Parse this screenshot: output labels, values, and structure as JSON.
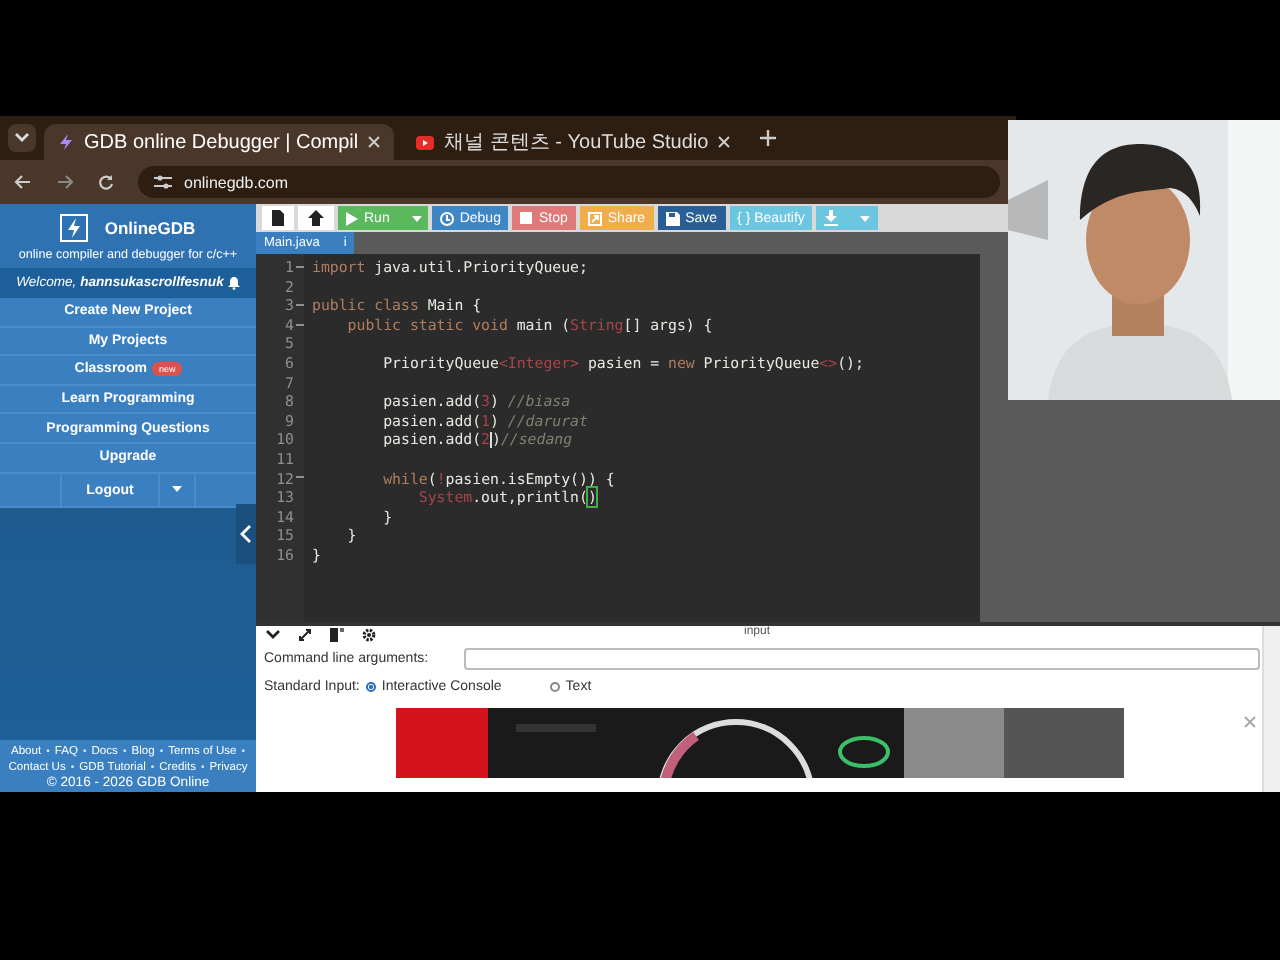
{
  "browser": {
    "tabs": [
      {
        "title": "GDB online Debugger | Compil",
        "selected": true,
        "kind": "gdb"
      },
      {
        "title": "채널 콘텐츠 - YouTube Studio",
        "selected": false,
        "kind": "youtube"
      }
    ],
    "url": "onlinegdb.com"
  },
  "sidebar": {
    "brand": "OnlineGDB",
    "tagline": "online compiler and debugger for c/c++",
    "welcome": "Welcome, **hannsukascrollfesnuk**",
    "menu": [
      {
        "label": "Create New Project",
        "kind": "link"
      },
      {
        "label": "My Projects",
        "kind": "link"
      },
      {
        "label": "Classroom",
        "kind": "link",
        "badge": "new"
      },
      {
        "label": "Learn Programming",
        "kind": "link"
      },
      {
        "label": "Programming Questions",
        "kind": "link"
      },
      {
        "label": "Upgrade",
        "kind": "link"
      },
      {
        "label": "Logout",
        "kind": "dropdown"
      }
    ],
    "footer": [
      [
        {
          "kind": "link",
          "text": "About"
        },
        {
          "kind": "sep",
          "text": "•"
        },
        {
          "kind": "link",
          "text": "FAQ"
        },
        {
          "kind": "sep",
          "text": "•"
        },
        {
          "kind": "link",
          "text": "Docs"
        },
        {
          "kind": "sep",
          "text": "•"
        },
        {
          "kind": "link",
          "text": "Blog"
        },
        {
          "kind": "sep",
          "text": "•"
        },
        {
          "kind": "link",
          "text": "Terms of Use"
        },
        {
          "kind": "sep",
          "text": "•"
        }
      ],
      [
        {
          "kind": "link",
          "text": "Contact Us"
        },
        {
          "kind": "sep",
          "text": "•"
        },
        {
          "kind": "link",
          "text": "GDB Tutorial"
        },
        {
          "kind": "sep",
          "text": "•"
        },
        {
          "kind": "link",
          "text": "Credits"
        },
        {
          "kind": "sep",
          "text": "•"
        },
        {
          "kind": "link",
          "text": "Privacy"
        }
      ]
    ],
    "copyright": "© 2016 - 2026 GDB Online"
  },
  "toolbar": [
    {
      "kind": "new-file"
    },
    {
      "kind": "upload"
    },
    {
      "kind": "run",
      "label": "Run",
      "caret": true
    },
    {
      "kind": "debug",
      "label": "Debug"
    },
    {
      "kind": "stop",
      "label": "Stop"
    },
    {
      "kind": "share",
      "label": "Share"
    },
    {
      "kind": "save",
      "label": "Save"
    },
    {
      "kind": "beautify",
      "label": "{ } Beautify"
    },
    {
      "kind": "download",
      "caret": true
    }
  ],
  "file_tab": {
    "name": "Main.java",
    "info": "i"
  },
  "code": [
    {
      "n": "1",
      "fold": true,
      "tokens": [
        {
          "kind": "kw",
          "t": "import"
        },
        {
          "kind": "plain",
          "t": " java.util.PriorityQueue;"
        }
      ]
    },
    {
      "n": "2",
      "fold": false
    },
    {
      "n": "3",
      "fold": true,
      "tokens": [
        {
          "kind": "kw",
          "t": "public class"
        },
        {
          "kind": "plain",
          "t": " Main {"
        }
      ]
    },
    {
      "n": "4",
      "fold": true,
      "tokens": [
        {
          "kind": "kw",
          "t": "    public static void"
        },
        {
          "kind": "plain",
          "t": " main ("
        },
        {
          "kind": "type",
          "t": "String"
        },
        {
          "kind": "plain",
          "t": "[] args) {"
        }
      ]
    },
    {
      "n": "5",
      "fold": false
    },
    {
      "n": "6",
      "fold": false,
      "tokens": [
        {
          "kind": "plain",
          "t": "        PriorityQueue"
        },
        {
          "kind": "type",
          "t": "<Integer>"
        },
        {
          "kind": "plain",
          "t": " pasien = "
        },
        {
          "kind": "kw",
          "t": "new"
        },
        {
          "kind": "plain",
          "t": " PriorityQueue"
        },
        {
          "kind": "type",
          "t": "<>"
        },
        {
          "kind": "plain",
          "t": "();"
        }
      ]
    },
    {
      "n": "7",
      "fold": false
    },
    {
      "n": "8",
      "fold": false,
      "tokens": [
        {
          "kind": "plain",
          "t": "        pasien.add("
        },
        {
          "kind": "num",
          "t": "3"
        },
        {
          "kind": "plain",
          "t": ") "
        },
        {
          "kind": "comment",
          "t": "//biasa"
        }
      ]
    },
    {
      "n": "9",
      "fold": false,
      "tokens": [
        {
          "kind": "plain",
          "t": "        pasien.add("
        },
        {
          "kind": "num",
          "t": "1"
        },
        {
          "kind": "plain",
          "t": ") "
        },
        {
          "kind": "comment",
          "t": "//darurat"
        }
      ]
    },
    {
      "n": "10",
      "fold": false,
      "tokens": [
        {
          "kind": "plain",
          "t": "        pasien.add("
        },
        {
          "kind": "num",
          "t": "2"
        },
        {
          "kind": "cursor"
        },
        {
          "kind": "plain",
          "t": ")"
        },
        {
          "kind": "comment",
          "t": "//sedang"
        }
      ]
    },
    {
      "n": "11",
      "fold": false
    },
    {
      "n": "12",
      "fold": true,
      "tokens": [
        {
          "kind": "kw",
          "t": "        while"
        },
        {
          "kind": "plain",
          "t": "("
        },
        {
          "kind": "type",
          "t": "!"
        },
        {
          "kind": "plain",
          "t": "pasien.isEmpty()) {"
        }
      ]
    },
    {
      "n": "13",
      "fold": false,
      "tokens": [
        {
          "kind": "type",
          "t": "            System"
        },
        {
          "kind": "plain",
          "t": ".out,println("
        },
        {
          "kind": "match",
          "t": ")"
        }
      ]
    },
    {
      "n": "14",
      "fold": false,
      "tokens": [
        {
          "kind": "plain",
          "t": "        }"
        }
      ]
    },
    {
      "n": "15",
      "fold": false,
      "tokens": [
        {
          "kind": "plain",
          "t": "    }"
        }
      ]
    },
    {
      "n": "16",
      "fold": false,
      "tokens": [
        {
          "kind": "plain",
          "t": "}"
        }
      ]
    }
  ],
  "panel": {
    "title": "input",
    "args_label": "Command line arguments:",
    "stdin_label": "Standard Input:",
    "options": [
      {
        "label": "Interactive Console",
        "selected": true
      },
      {
        "label": "Text",
        "selected": false
      }
    ]
  }
}
